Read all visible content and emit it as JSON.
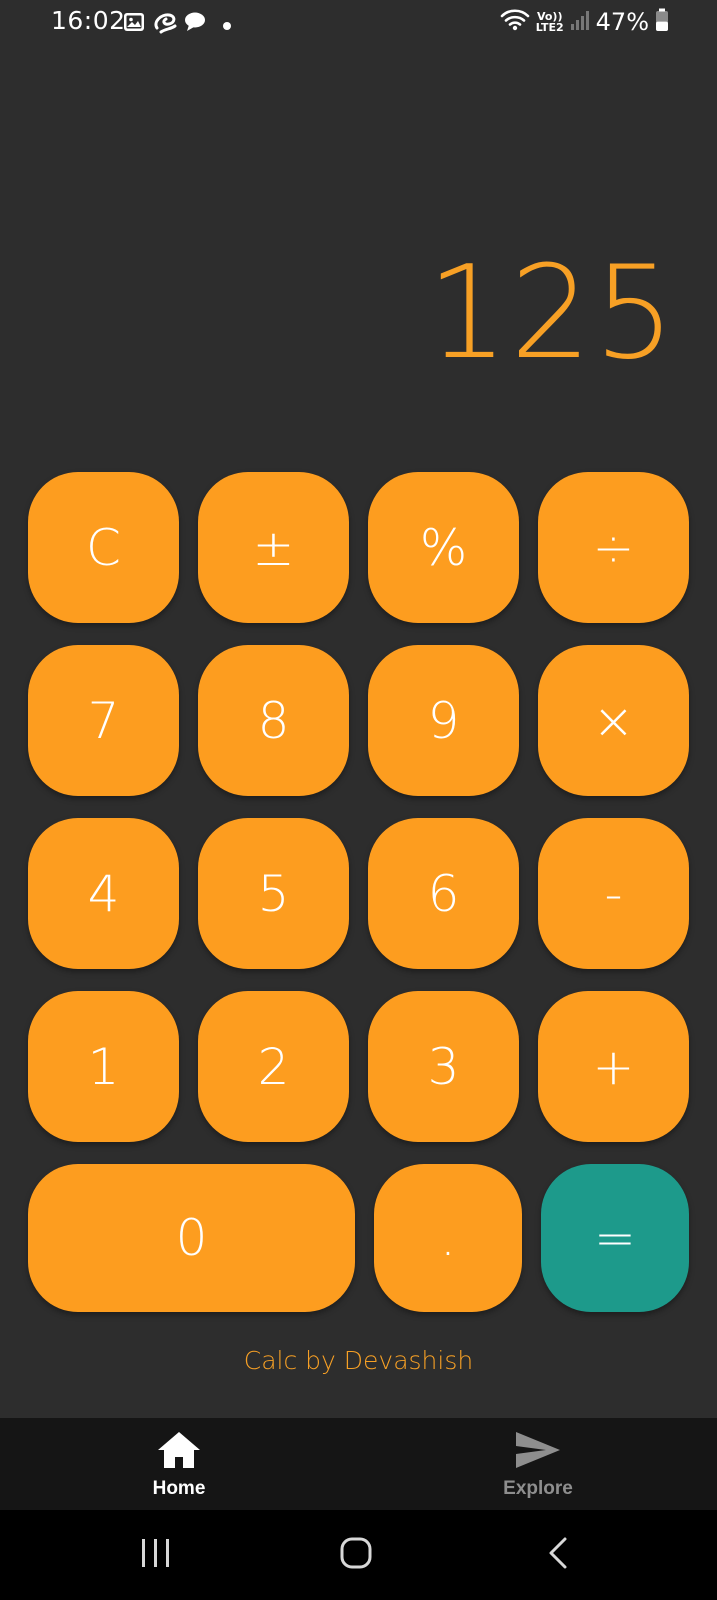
{
  "status_bar": {
    "time": "16:02",
    "network_label_top": "Vo))",
    "network_label_bottom": "LTE2",
    "battery_percent": "47%",
    "battery_level": 0.47,
    "notification_icons": [
      "gallery-icon",
      "airtel-icon",
      "chat-icon",
      "dot-icon"
    ]
  },
  "display": {
    "value": "125"
  },
  "keypad": {
    "rows": [
      [
        "C",
        "±",
        "%",
        "÷"
      ],
      [
        "7",
        "8",
        "9",
        "×"
      ],
      [
        "4",
        "5",
        "6",
        "-"
      ],
      [
        "1",
        "2",
        "3",
        "+"
      ],
      [
        "0",
        ".",
        "="
      ]
    ]
  },
  "footer": {
    "credit": "Calc by Devashish"
  },
  "bottom_nav": {
    "items": [
      {
        "label": "Home",
        "icon": "home-icon",
        "active": true
      },
      {
        "label": "Explore",
        "icon": "send-icon",
        "active": false
      }
    ]
  },
  "colors": {
    "background": "#2d2d2d",
    "key": "#fd9d1f",
    "equals_key": "#1d9a8b",
    "accent_text": "#f7a025",
    "nav_bg": "#151515"
  }
}
